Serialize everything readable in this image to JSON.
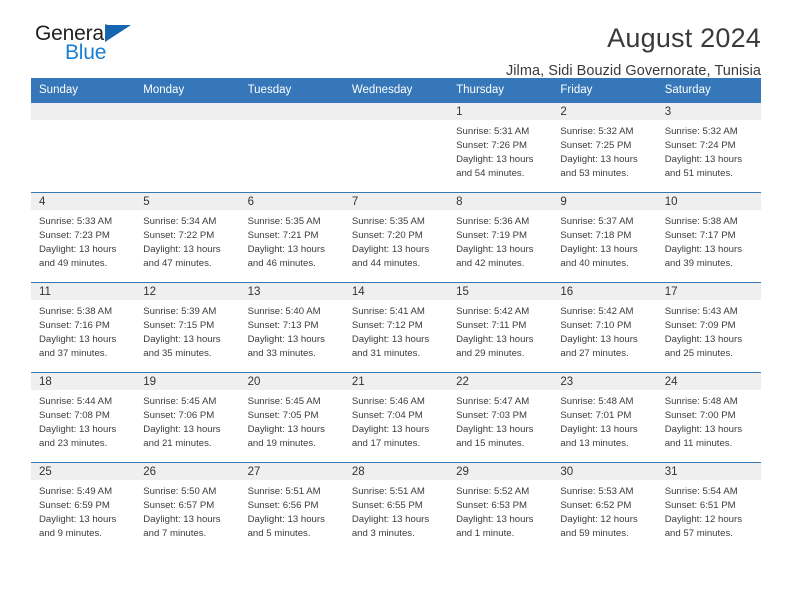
{
  "brand": {
    "name_dark": "General",
    "name_light": "Blue",
    "triangle_icon": "triangle-logo-icon",
    "color_dark": "#231f20",
    "color_light": "#1a7fd4"
  },
  "header": {
    "title": "August 2024",
    "subtitle": "Jilma, Sidi Bouzid Governorate, Tunisia"
  },
  "calendar": {
    "accent_color": "#3577b8",
    "band_color": "#efefef",
    "weekday_headers": [
      "Sunday",
      "Monday",
      "Tuesday",
      "Wednesday",
      "Thursday",
      "Friday",
      "Saturday"
    ],
    "weeks": [
      [
        {
          "day": "",
          "lines": []
        },
        {
          "day": "",
          "lines": []
        },
        {
          "day": "",
          "lines": []
        },
        {
          "day": "",
          "lines": []
        },
        {
          "day": "1",
          "lines": [
            "Sunrise: 5:31 AM",
            "Sunset: 7:26 PM",
            "Daylight: 13 hours",
            "and 54 minutes."
          ]
        },
        {
          "day": "2",
          "lines": [
            "Sunrise: 5:32 AM",
            "Sunset: 7:25 PM",
            "Daylight: 13 hours",
            "and 53 minutes."
          ]
        },
        {
          "day": "3",
          "lines": [
            "Sunrise: 5:32 AM",
            "Sunset: 7:24 PM",
            "Daylight: 13 hours",
            "and 51 minutes."
          ]
        }
      ],
      [
        {
          "day": "4",
          "lines": [
            "Sunrise: 5:33 AM",
            "Sunset: 7:23 PM",
            "Daylight: 13 hours",
            "and 49 minutes."
          ]
        },
        {
          "day": "5",
          "lines": [
            "Sunrise: 5:34 AM",
            "Sunset: 7:22 PM",
            "Daylight: 13 hours",
            "and 47 minutes."
          ]
        },
        {
          "day": "6",
          "lines": [
            "Sunrise: 5:35 AM",
            "Sunset: 7:21 PM",
            "Daylight: 13 hours",
            "and 46 minutes."
          ]
        },
        {
          "day": "7",
          "lines": [
            "Sunrise: 5:35 AM",
            "Sunset: 7:20 PM",
            "Daylight: 13 hours",
            "and 44 minutes."
          ]
        },
        {
          "day": "8",
          "lines": [
            "Sunrise: 5:36 AM",
            "Sunset: 7:19 PM",
            "Daylight: 13 hours",
            "and 42 minutes."
          ]
        },
        {
          "day": "9",
          "lines": [
            "Sunrise: 5:37 AM",
            "Sunset: 7:18 PM",
            "Daylight: 13 hours",
            "and 40 minutes."
          ]
        },
        {
          "day": "10",
          "lines": [
            "Sunrise: 5:38 AM",
            "Sunset: 7:17 PM",
            "Daylight: 13 hours",
            "and 39 minutes."
          ]
        }
      ],
      [
        {
          "day": "11",
          "lines": [
            "Sunrise: 5:38 AM",
            "Sunset: 7:16 PM",
            "Daylight: 13 hours",
            "and 37 minutes."
          ]
        },
        {
          "day": "12",
          "lines": [
            "Sunrise: 5:39 AM",
            "Sunset: 7:15 PM",
            "Daylight: 13 hours",
            "and 35 minutes."
          ]
        },
        {
          "day": "13",
          "lines": [
            "Sunrise: 5:40 AM",
            "Sunset: 7:13 PM",
            "Daylight: 13 hours",
            "and 33 minutes."
          ]
        },
        {
          "day": "14",
          "lines": [
            "Sunrise: 5:41 AM",
            "Sunset: 7:12 PM",
            "Daylight: 13 hours",
            "and 31 minutes."
          ]
        },
        {
          "day": "15",
          "lines": [
            "Sunrise: 5:42 AM",
            "Sunset: 7:11 PM",
            "Daylight: 13 hours",
            "and 29 minutes."
          ]
        },
        {
          "day": "16",
          "lines": [
            "Sunrise: 5:42 AM",
            "Sunset: 7:10 PM",
            "Daylight: 13 hours",
            "and 27 minutes."
          ]
        },
        {
          "day": "17",
          "lines": [
            "Sunrise: 5:43 AM",
            "Sunset: 7:09 PM",
            "Daylight: 13 hours",
            "and 25 minutes."
          ]
        }
      ],
      [
        {
          "day": "18",
          "lines": [
            "Sunrise: 5:44 AM",
            "Sunset: 7:08 PM",
            "Daylight: 13 hours",
            "and 23 minutes."
          ]
        },
        {
          "day": "19",
          "lines": [
            "Sunrise: 5:45 AM",
            "Sunset: 7:06 PM",
            "Daylight: 13 hours",
            "and 21 minutes."
          ]
        },
        {
          "day": "20",
          "lines": [
            "Sunrise: 5:45 AM",
            "Sunset: 7:05 PM",
            "Daylight: 13 hours",
            "and 19 minutes."
          ]
        },
        {
          "day": "21",
          "lines": [
            "Sunrise: 5:46 AM",
            "Sunset: 7:04 PM",
            "Daylight: 13 hours",
            "and 17 minutes."
          ]
        },
        {
          "day": "22",
          "lines": [
            "Sunrise: 5:47 AM",
            "Sunset: 7:03 PM",
            "Daylight: 13 hours",
            "and 15 minutes."
          ]
        },
        {
          "day": "23",
          "lines": [
            "Sunrise: 5:48 AM",
            "Sunset: 7:01 PM",
            "Daylight: 13 hours",
            "and 13 minutes."
          ]
        },
        {
          "day": "24",
          "lines": [
            "Sunrise: 5:48 AM",
            "Sunset: 7:00 PM",
            "Daylight: 13 hours",
            "and 11 minutes."
          ]
        }
      ],
      [
        {
          "day": "25",
          "lines": [
            "Sunrise: 5:49 AM",
            "Sunset: 6:59 PM",
            "Daylight: 13 hours",
            "and 9 minutes."
          ]
        },
        {
          "day": "26",
          "lines": [
            "Sunrise: 5:50 AM",
            "Sunset: 6:57 PM",
            "Daylight: 13 hours",
            "and 7 minutes."
          ]
        },
        {
          "day": "27",
          "lines": [
            "Sunrise: 5:51 AM",
            "Sunset: 6:56 PM",
            "Daylight: 13 hours",
            "and 5 minutes."
          ]
        },
        {
          "day": "28",
          "lines": [
            "Sunrise: 5:51 AM",
            "Sunset: 6:55 PM",
            "Daylight: 13 hours",
            "and 3 minutes."
          ]
        },
        {
          "day": "29",
          "lines": [
            "Sunrise: 5:52 AM",
            "Sunset: 6:53 PM",
            "Daylight: 13 hours",
            "and 1 minute."
          ]
        },
        {
          "day": "30",
          "lines": [
            "Sunrise: 5:53 AM",
            "Sunset: 6:52 PM",
            "Daylight: 12 hours",
            "and 59 minutes."
          ]
        },
        {
          "day": "31",
          "lines": [
            "Sunrise: 5:54 AM",
            "Sunset: 6:51 PM",
            "Daylight: 12 hours",
            "and 57 minutes."
          ]
        }
      ]
    ]
  }
}
